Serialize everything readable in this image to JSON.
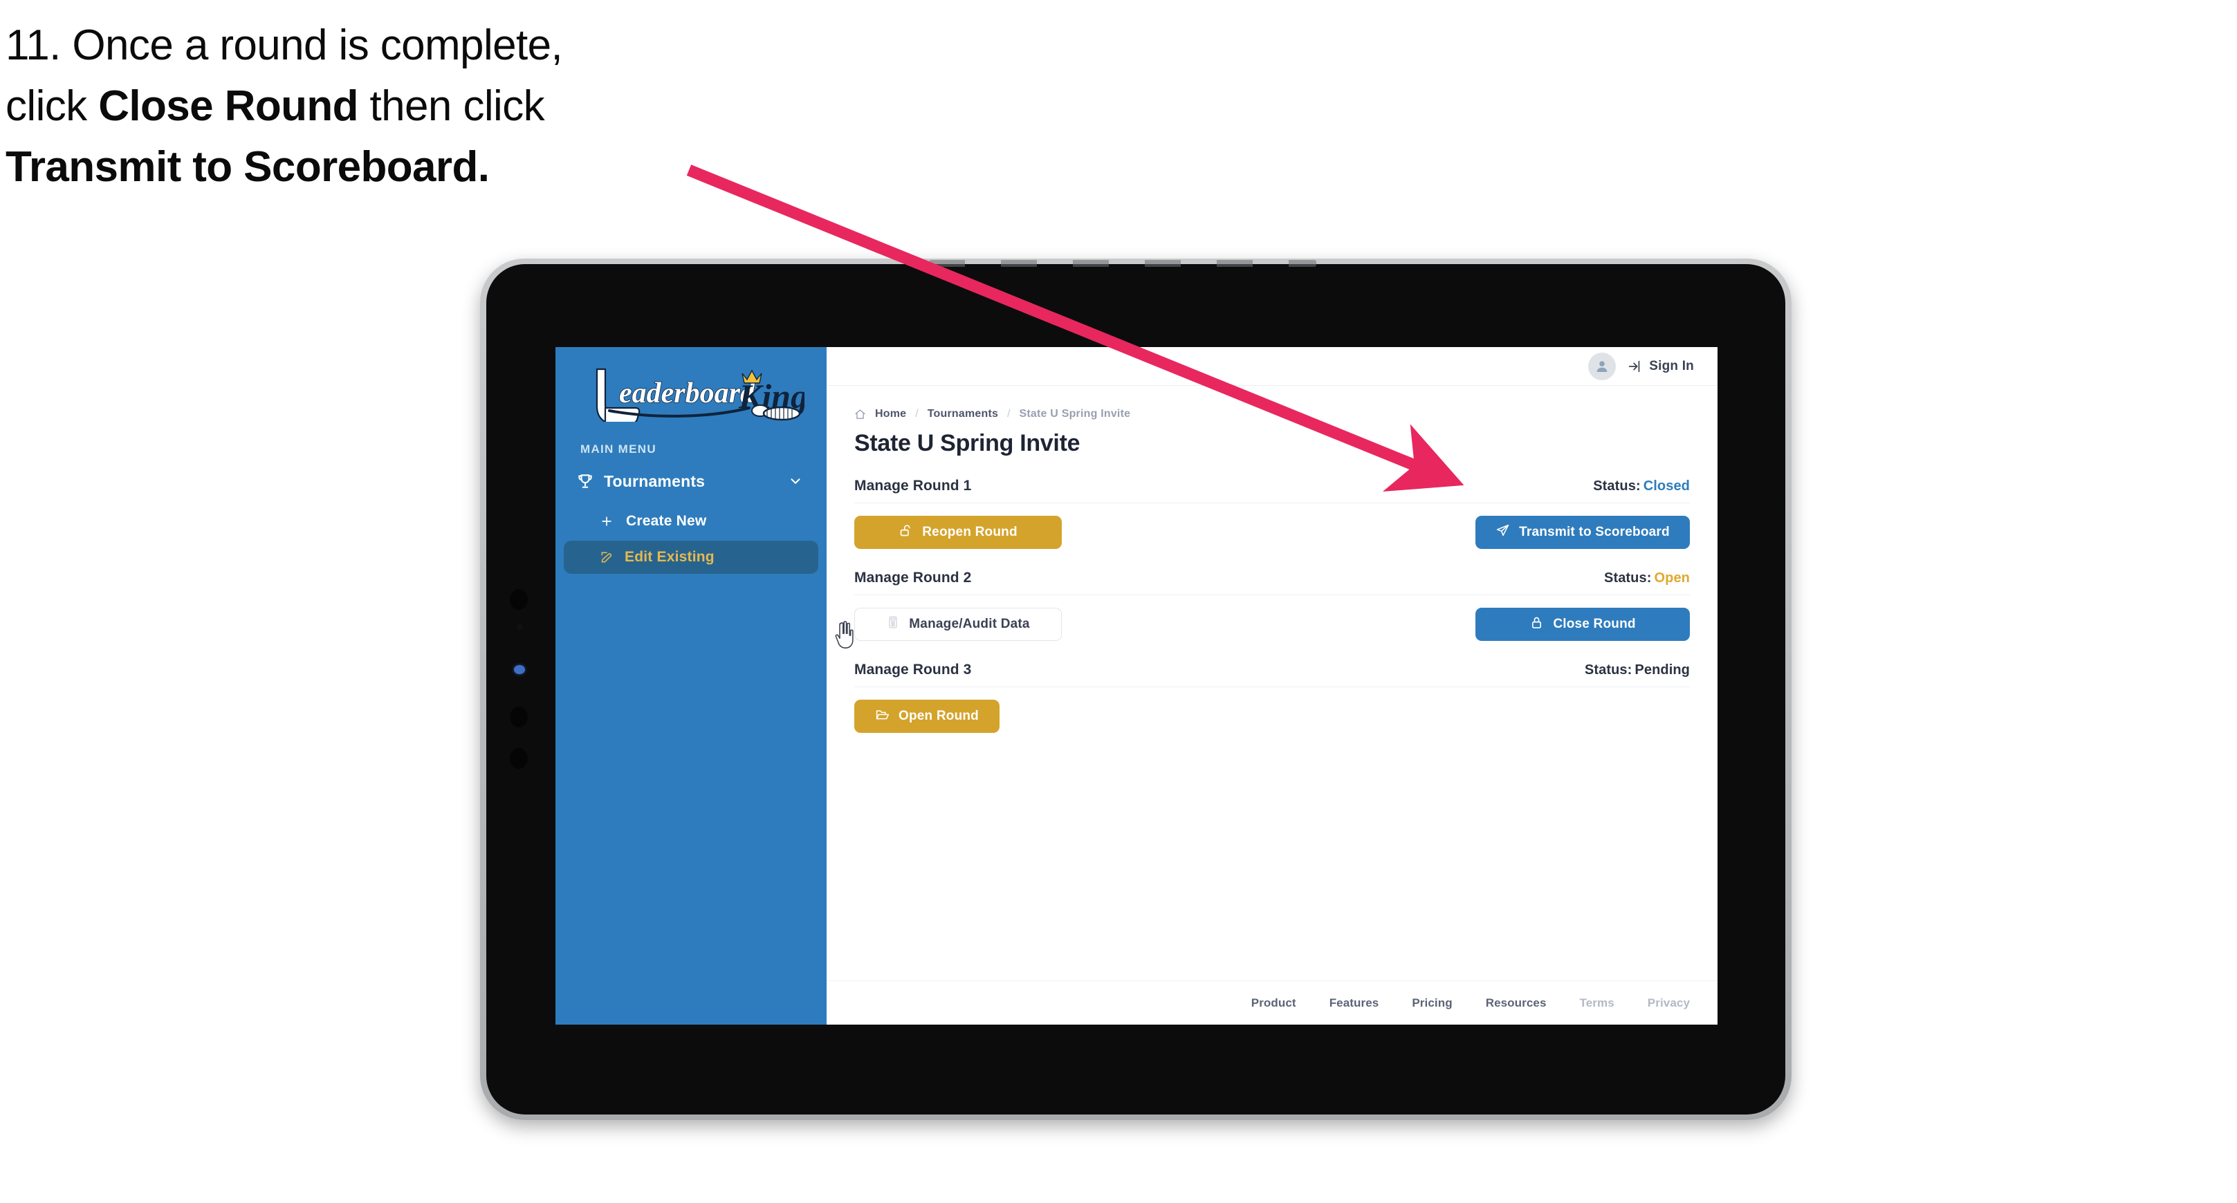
{
  "caption": {
    "line1_plain": "11. Once a round is complete,",
    "line2_pre": "click ",
    "line2_bold": "Close Round",
    "line2_post": " then click",
    "line3_bold": "Transmit to Scoreboard."
  },
  "annotation": {
    "arrow_color": "#e8275f",
    "points_to": "transmit-to-scoreboard-button"
  },
  "app": {
    "sidebar": {
      "logo_text": "LeaderboardKing",
      "logo_word_left": "Leaderboard",
      "logo_word_right": "King",
      "menu_label": "MAIN MENU",
      "items": [
        {
          "label": "Tournaments",
          "icon": "trophy-icon",
          "expanded": true,
          "chevron": "chevron-down-icon"
        },
        {
          "label": "Create New",
          "icon": "plus-icon",
          "active": false
        },
        {
          "label": "Edit Existing",
          "icon": "pencil-edit-icon",
          "active": true
        }
      ],
      "bg_color": "#2e7cbd",
      "active_bg_color": "#26648f",
      "active_text_color": "#e7b84e"
    },
    "topbar": {
      "avatar_icon": "user-avatar-icon",
      "signin_icon": "sign-in-arrow-icon",
      "signin_label": "Sign In"
    },
    "breadcrumb": {
      "home_icon": "home-icon",
      "items": [
        "Home",
        "Tournaments",
        "State U Spring Invite"
      ],
      "separator": "/"
    },
    "page_title": "State U Spring Invite",
    "rounds": [
      {
        "title": "Manage Round 1",
        "status_label": "Status:",
        "status_value": "Closed",
        "status_class": "closed",
        "left_button": {
          "label": "Reopen Round",
          "icon": "unlock-icon",
          "style": "gold"
        },
        "right_button": {
          "label": "Transmit to Scoreboard",
          "icon": "paper-plane-icon",
          "style": "blue"
        }
      },
      {
        "title": "Manage Round 2",
        "status_label": "Status:",
        "status_value": "Open",
        "status_class": "open",
        "left_button": {
          "label": "Manage/Audit Data",
          "icon": "calculator-icon",
          "style": "ghost"
        },
        "right_button": {
          "label": "Close Round",
          "icon": "lock-icon",
          "style": "blue"
        }
      },
      {
        "title": "Manage Round 3",
        "status_label": "Status:",
        "status_value": "Pending",
        "status_class": "pending",
        "left_button": {
          "label": "Open Round",
          "icon": "folder-open-icon",
          "style": "gold"
        },
        "right_button": null
      }
    ],
    "footer": {
      "links": [
        {
          "label": "Product",
          "dim": false
        },
        {
          "label": "Features",
          "dim": false
        },
        {
          "label": "Pricing",
          "dim": false
        },
        {
          "label": "Resources",
          "dim": false
        },
        {
          "label": "Terms",
          "dim": true
        },
        {
          "label": "Privacy",
          "dim": true
        }
      ]
    },
    "colors": {
      "brand_blue": "#2e7cbd",
      "gold": "#d4a32b",
      "status_open": "#e0a92e",
      "text_dark": "#2b3242"
    }
  }
}
